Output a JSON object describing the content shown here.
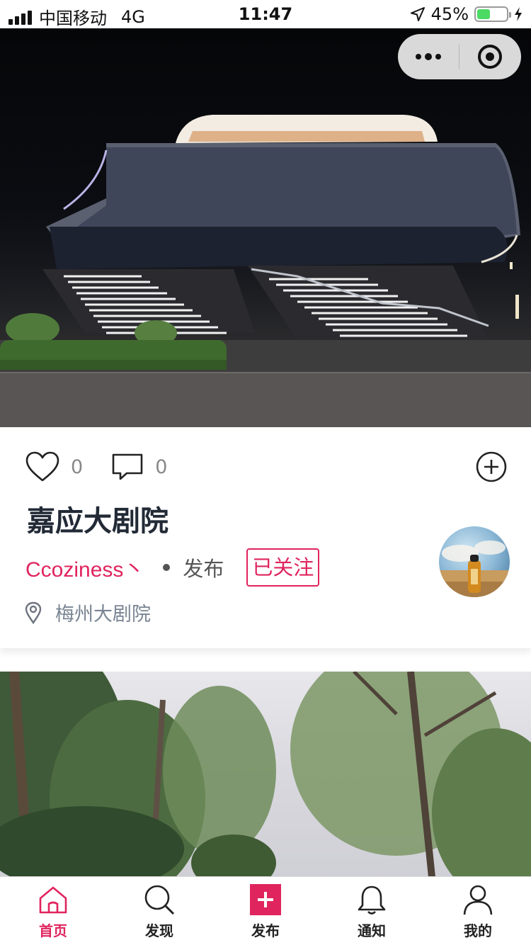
{
  "status_bar": {
    "carrier": "中国移动",
    "network": "4G",
    "time": "11:47",
    "battery": "45%",
    "battery_level": 0.45
  },
  "capsule": {
    "more_icon": "more-dots-icon",
    "close_icon": "target-circle-icon"
  },
  "post": {
    "likes": "0",
    "comments": "0",
    "title": "嘉应大剧院",
    "author": "Ccoziness丶",
    "publish_label": "发布",
    "follow_label": "已关注",
    "location": "梅州大剧院"
  },
  "tabbar": {
    "items": [
      {
        "label": "首页",
        "icon": "home-icon",
        "active": true
      },
      {
        "label": "发现",
        "icon": "search-icon",
        "active": false
      },
      {
        "label": "发布",
        "icon": "plus-square-icon",
        "active": false
      },
      {
        "label": "通知",
        "icon": "bell-icon",
        "active": false
      },
      {
        "label": "我的",
        "icon": "user-icon",
        "active": false
      }
    ]
  },
  "colors": {
    "accent": "#e0245e",
    "title": "#222a36",
    "muted": "#7a8593"
  }
}
